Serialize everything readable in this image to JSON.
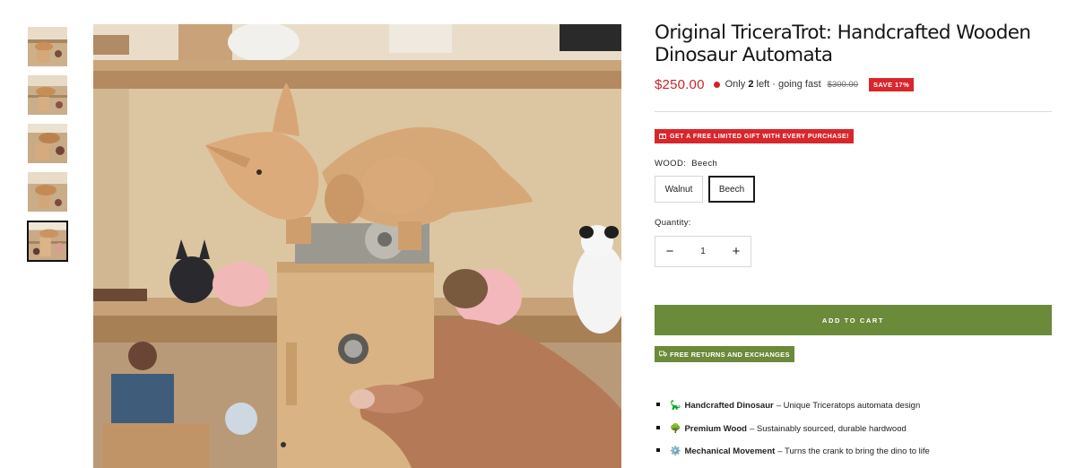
{
  "product": {
    "title": "Original TriceraTrot: Handcrafted Wooden Dinosaur Automata",
    "price": "$250.00",
    "stock_prefix": "Only",
    "stock_count": "2",
    "stock_suffix": "left · going fast",
    "compare_price": "$300.00",
    "save_badge": "SAVE 17%"
  },
  "gift_banner": "GET A FREE LIMITED GIFT WITH EVERY PURCHASE!",
  "wood": {
    "label": "WOOD:",
    "selected": "Beech",
    "options": [
      "Walnut",
      "Beech"
    ]
  },
  "quantity": {
    "label": "Quantity:",
    "value": "1",
    "minus": "−",
    "plus": "+"
  },
  "add_to_cart": "ADD TO CART",
  "returns_banner": "FREE RETURNS AND EXCHANGES",
  "features": [
    {
      "icon": "🦕",
      "title": "Handcrafted Dinosaur",
      "text": "– Unique Triceratops automata design"
    },
    {
      "icon": "🌳",
      "title": "Premium Wood",
      "text": "– Sustainably sourced, durable hardwood"
    },
    {
      "icon": "⚙️",
      "title": "Mechanical Movement",
      "text": "– Turns the crank to bring the dino to life"
    }
  ],
  "colors": {
    "sale_red": "#d8262c",
    "cart_green": "#6b8a3a"
  },
  "gallery": {
    "thumbnail_count": 5,
    "active_thumbnail": 5
  }
}
